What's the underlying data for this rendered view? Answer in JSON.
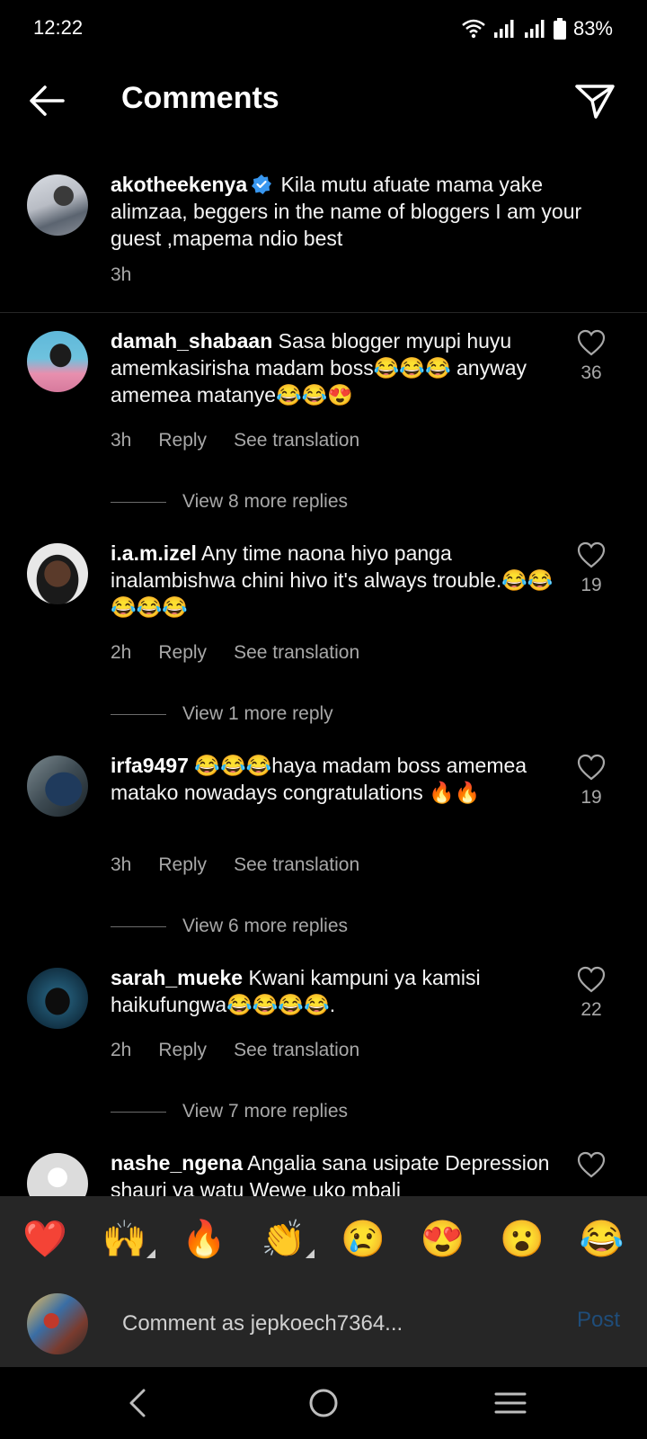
{
  "status": {
    "time": "12:22",
    "battery": "83%"
  },
  "header": {
    "title": "Comments"
  },
  "caption": {
    "username": "akotheekenya",
    "text": "Kila mutu afuate mama yake alimzaa, beggers in the name of bloggers I am your guest ,mapema ndio best",
    "time": "3h"
  },
  "labels": {
    "reply": "Reply",
    "see_translation": "See translation"
  },
  "comments": [
    {
      "username": "damah_shabaan",
      "text": "Sasa blogger myupi huyu amemkasirisha madam boss😂😂😂 anyway amemea matanye😂😂😍",
      "time": "3h",
      "likes": "36",
      "view_replies": "View 8 more replies"
    },
    {
      "username": "i.a.m.izel",
      "text": "Any time naona  hiyo panga inalambishwa chini hivo it's always trouble.😂😂😂😂😂",
      "time": "2h",
      "likes": "19",
      "view_replies": "View 1 more reply"
    },
    {
      "username": "irfa9497",
      "text": "😂😂😂haya madam boss amemea matako nowadays congratulations 🔥🔥",
      "time": "3h",
      "likes": "19",
      "view_replies": "View 6 more replies"
    },
    {
      "username": "sarah_mueke",
      "text": "Kwani kampuni ya kamisi haikufungwa😂😂😂😂.",
      "time": "2h",
      "likes": "22",
      "view_replies": "View 7 more replies"
    },
    {
      "username": "nashe_ngena",
      "text": "Angalia sana usipate Depression shauri ya watu Wewe uko mbali"
    }
  ],
  "emoji_bar": [
    "❤️",
    "🙌",
    "🔥",
    "👏",
    "😢",
    "😍",
    "😮",
    "😂"
  ],
  "composer": {
    "placeholder": "Comment as jepkoech7364...",
    "post_label": "Post"
  },
  "colors": {
    "background": "#000000",
    "muted_text": "#a8a8a8",
    "verified": "#3897f0",
    "post_disabled": "#1f4d7a"
  }
}
